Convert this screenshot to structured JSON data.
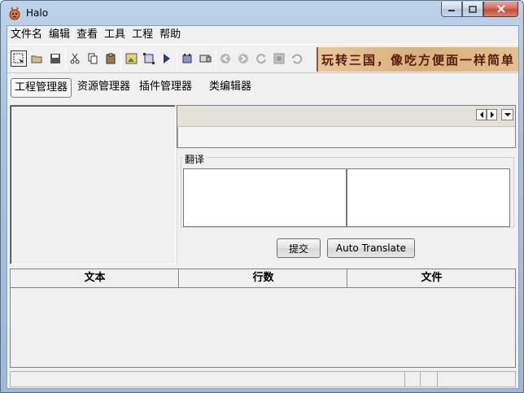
{
  "window": {
    "title": "Halo"
  },
  "menu": [
    "文件名",
    "编辑",
    "查看",
    "工具",
    "工程",
    "帮助"
  ],
  "toolbar": {
    "icons": [
      "select-icon",
      "open-icon",
      "save-icon",
      "cut-icon",
      "copy-icon",
      "paste-icon",
      "image-icon",
      "frame-icon",
      "play-icon",
      "build-icon",
      "export-icon",
      "back-icon",
      "forward-icon",
      "refresh-icon",
      "stop-icon",
      "undo-icon"
    ],
    "banner_text": "玩转三国，像吃方便面一样简单"
  },
  "tabs": [
    "工程管理器",
    "资源管理器",
    "插件管理器",
    "类编辑器"
  ],
  "translate": {
    "group_label": "翻译",
    "submit_label": "提交",
    "auto_label": "Auto Translate"
  },
  "table": {
    "columns": [
      "文本",
      "行数",
      "文件"
    ]
  },
  "colors": {
    "titlebar": "#bcd3ea",
    "close": "#c74a35",
    "banner": "#e3c08e"
  }
}
